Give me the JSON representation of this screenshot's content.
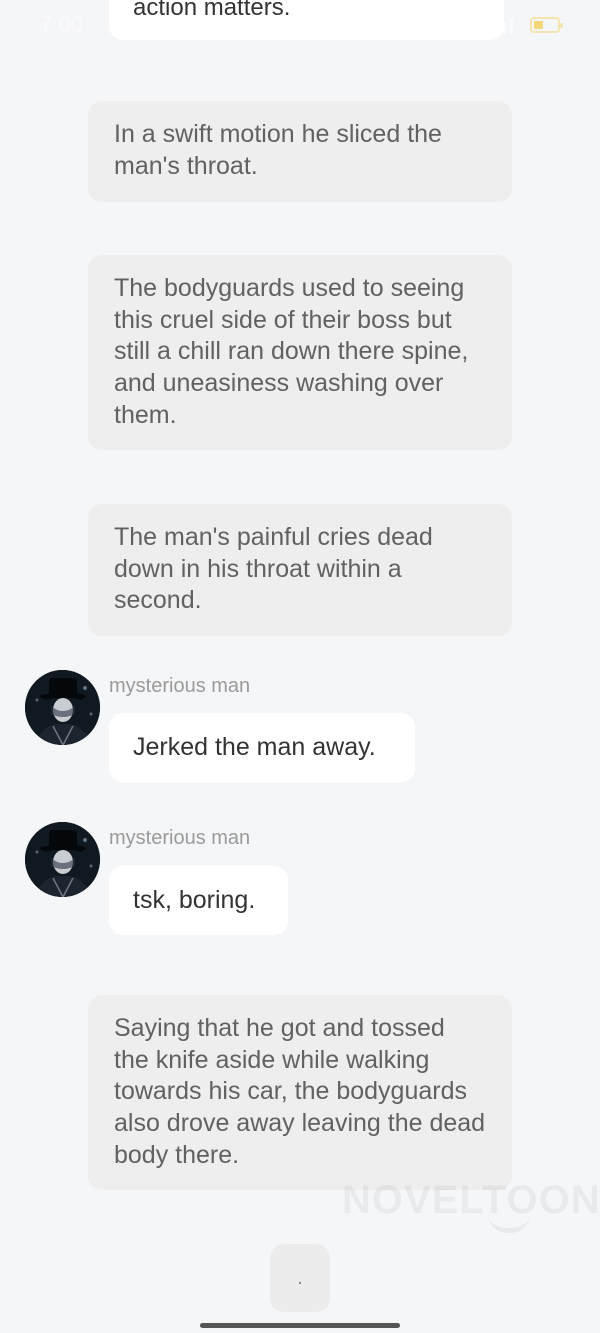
{
  "status_bar": {
    "time": "7:00"
  },
  "story": {
    "partial_bubble": "action matters.",
    "narration_1": "In a swift motion he sliced the man's throat.",
    "narration_2": "The bodyguards used to seeing this cruel side of their boss but still a chill ran down there spine, and uneasiness washing over them.",
    "narration_3": "The man's painful cries dead down in his throat within a second.",
    "message_1": {
      "speaker": "mysterious man",
      "text": "Jerked the man away."
    },
    "message_2": {
      "speaker": "mysterious man",
      "text": "tsk, boring."
    },
    "narration_4": "Saying that he got and tossed the knife aside while walking towards his car, the bodyguards also drove away leaving the dead body there."
  },
  "continue_button": {
    "label": "."
  },
  "watermark": "NOVELTOON"
}
